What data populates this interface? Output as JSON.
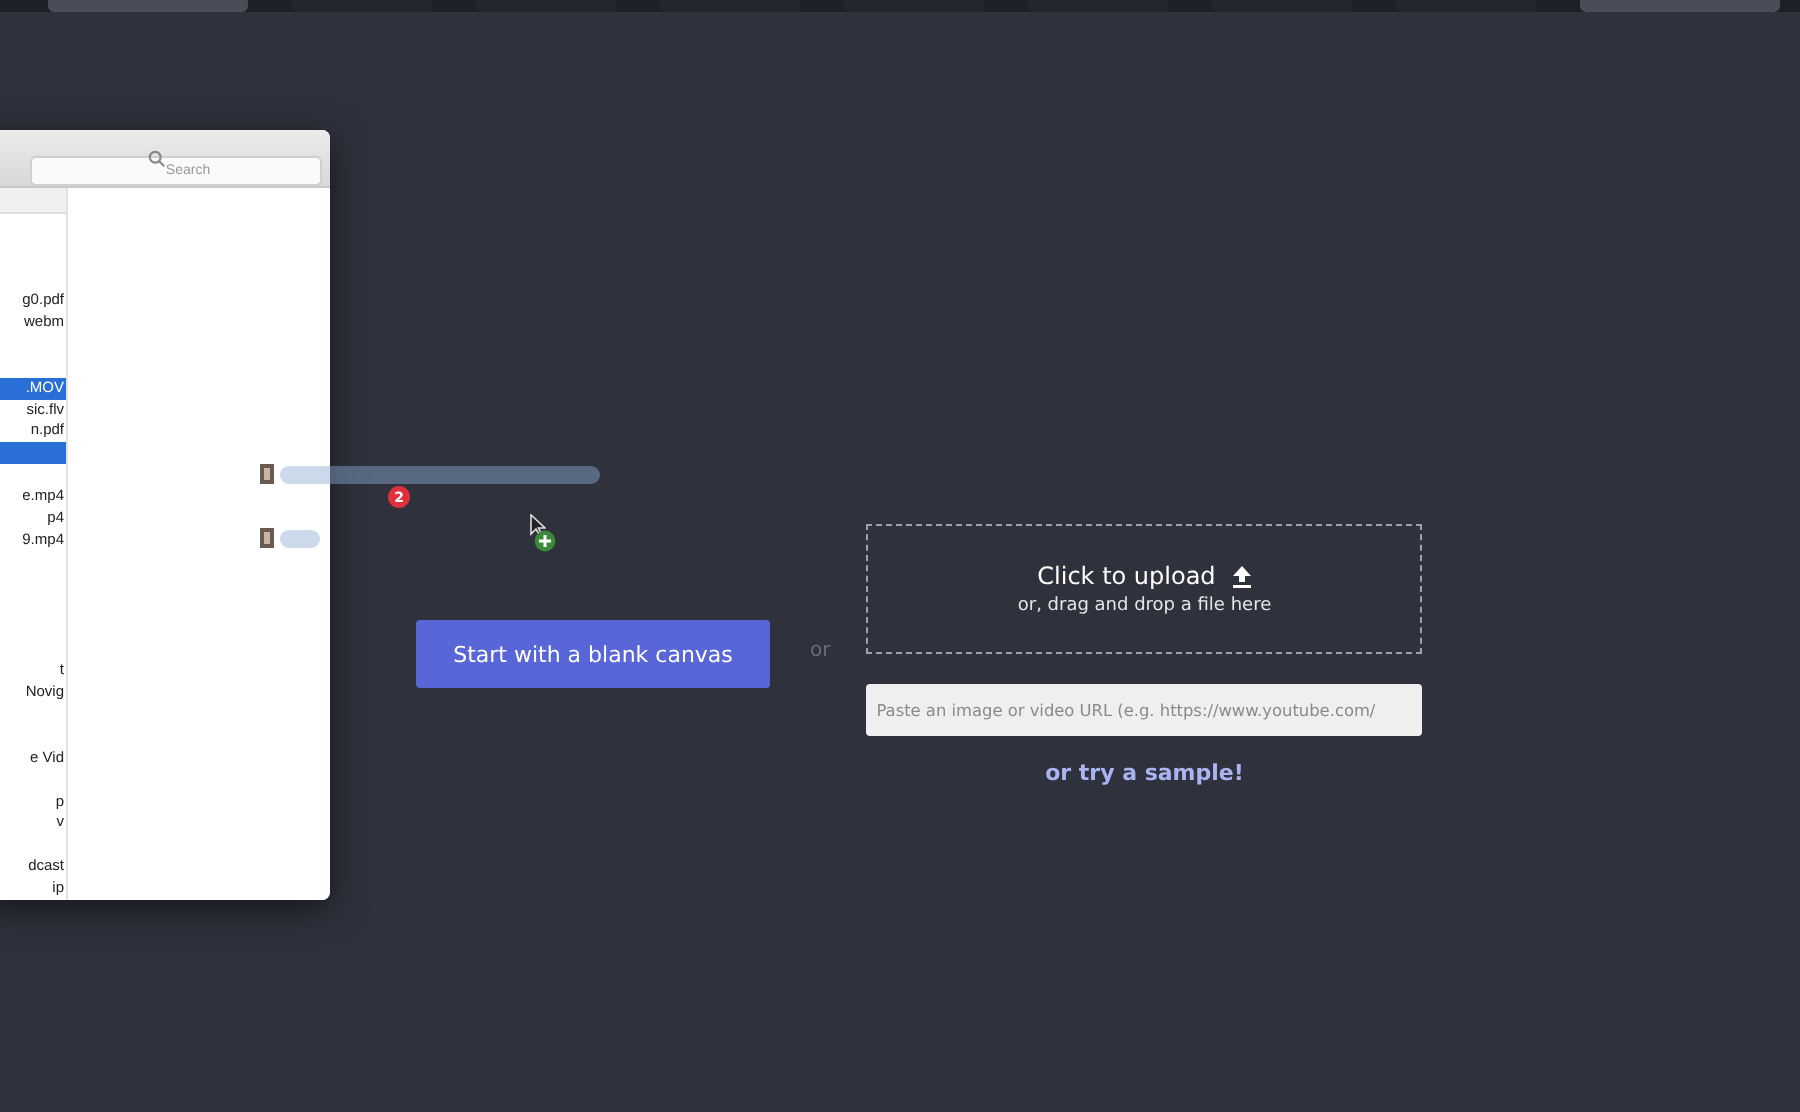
{
  "toolbar": {
    "tabs": [
      {
        "selected": true
      },
      {
        "selected": false
      },
      {
        "selected": false
      },
      {
        "selected": false
      },
      {
        "selected": false
      },
      {
        "selected": false
      },
      {
        "selected": false
      },
      {
        "selected": false
      },
      {
        "selected": true
      }
    ]
  },
  "finder": {
    "search": {
      "placeholder": "Search"
    },
    "files": [
      {
        "kind": "file",
        "name": "g0.pdf",
        "selected": false
      },
      {
        "kind": "file",
        "name": "webm",
        "selected": false
      },
      {
        "kind": "blank"
      },
      {
        "kind": "blank"
      },
      {
        "kind": "file",
        "name": ".MOV",
        "selected": true
      },
      {
        "kind": "file",
        "name": "sic.flv",
        "selected": false
      },
      {
        "kind": "file",
        "name": "n.pdf",
        "selected": false
      },
      {
        "kind": "file",
        "selected": true
      },
      {
        "kind": "blank"
      },
      {
        "kind": "file",
        "name": "e.mp4",
        "selected": false
      },
      {
        "kind": "file",
        "name": "p4",
        "selected": false
      },
      {
        "kind": "file",
        "name": "9.mp4",
        "selected": false
      },
      {
        "kind": "blank"
      },
      {
        "kind": "blank"
      },
      {
        "kind": "blank"
      },
      {
        "kind": "blank"
      },
      {
        "kind": "blank"
      },
      {
        "kind": "file",
        "name": "t",
        "selected": false
      },
      {
        "kind": "file",
        "name": " Novig",
        "selected": false
      },
      {
        "kind": "blank"
      },
      {
        "kind": "blank"
      },
      {
        "kind": "file",
        "name": "e Vid",
        "selected": false
      },
      {
        "kind": "blank"
      },
      {
        "kind": "file",
        "name": "p",
        "selected": false
      },
      {
        "kind": "file",
        "name": "v",
        "selected": false
      },
      {
        "kind": "blank"
      },
      {
        "kind": "file",
        "name": "dcast",
        "selected": false
      },
      {
        "kind": "file",
        "name": "ip",
        "selected": false
      }
    ]
  },
  "drag": {
    "count": "2"
  },
  "main": {
    "blank_button": "Start with a blank canvas",
    "separator": "or",
    "upload": {
      "title": "Click to upload",
      "subtitle": "or, drag and drop a file here"
    },
    "url_field": {
      "placeholder": "Paste an image or video URL (e.g. https://www.youtube.com/"
    },
    "sample_link": "or try a sample!"
  }
}
